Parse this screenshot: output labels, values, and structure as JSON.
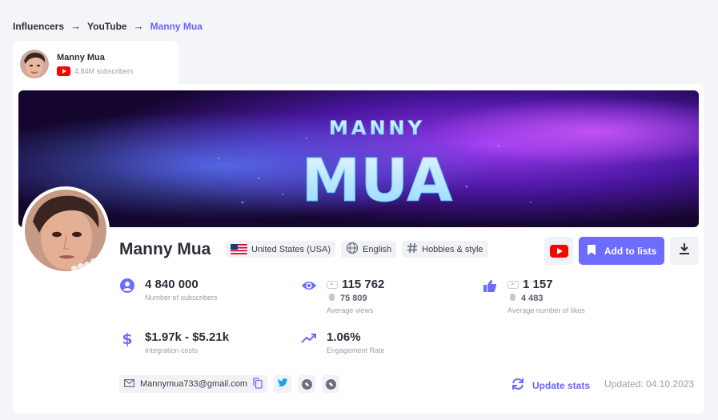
{
  "breadcrumb": {
    "items": [
      "Influencers",
      "YouTube",
      "Manny Mua"
    ],
    "separator": "→"
  },
  "profile_tab": {
    "name": "Manny Mua",
    "subscribers": "4.84M subscribers",
    "platform_icon": "youtube-icon"
  },
  "banner": {
    "line1": "MANNY",
    "line2": "MUA"
  },
  "profile": {
    "name": "Manny Mua",
    "tags": [
      {
        "icon": "us-flag-icon",
        "label": "United States (USA)"
      },
      {
        "icon": "globe-icon",
        "label": "English"
      },
      {
        "icon": "hashtag-icon",
        "label": "Hobbies & style"
      }
    ]
  },
  "actions": {
    "add_to_lists": "Add to lists"
  },
  "stats": {
    "subscribers": {
      "value": "4 840 000",
      "label": "Number of subscribers"
    },
    "views": {
      "value": "115 762",
      "sub": "75 809",
      "label": "Average views"
    },
    "likes": {
      "value": "1 157",
      "sub": "4 483",
      "label": "Average number of likes"
    },
    "cost": {
      "value": "$1.97k - $5.21k",
      "label": "Integration costs"
    },
    "engagement": {
      "value": "1.06%",
      "label": "Engagement Rate"
    }
  },
  "contacts": {
    "email": "Mannymua733@gmail.com"
  },
  "update": {
    "label": "Update stats",
    "updated": "Updated: 04.10.2023"
  },
  "colors": {
    "accent": "#6c6cff",
    "youtube": "#ff0000"
  }
}
